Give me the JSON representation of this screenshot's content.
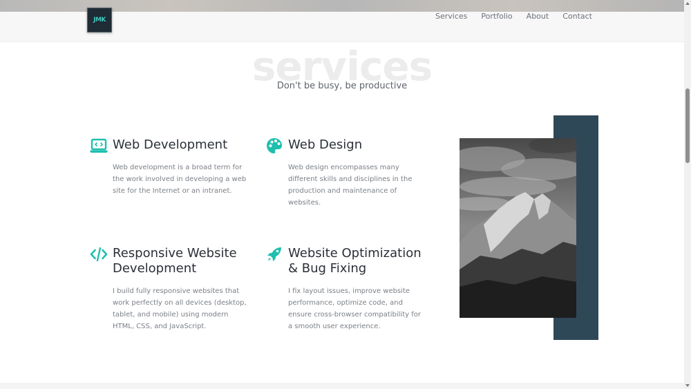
{
  "header": {
    "logo_text": "JMK",
    "nav": [
      {
        "label": "Services"
      },
      {
        "label": "Portfolio"
      },
      {
        "label": "About"
      },
      {
        "label": "Contact"
      }
    ]
  },
  "section": {
    "title": "services",
    "subtitle": "Don't be busy, be productive"
  },
  "services": [
    {
      "icon": "laptop-code-icon",
      "title": "Web Development",
      "description": "Web development is a broad term for the work involved in developing a web site for the Internet or an intranet."
    },
    {
      "icon": "palette-icon",
      "title": "Web Design",
      "description": "Web design encompasses many different skills and disciplines in the production and maintenance of websites."
    },
    {
      "icon": "code-icon",
      "title_line1": "Responsive Website",
      "title_line2": "Development",
      "description": "I build fully responsive websites that work perfectly on all devices (desktop, tablet, and mobile) using modern HTML, CSS, and JavaScript."
    },
    {
      "icon": "rocket-icon",
      "title_line1": "Website Optimization",
      "title_line2": "& Bug Fixing",
      "description": "I fix layout issues, improve website performance, optimize code, and ensure cross-browser compatibility for a smooth user experience."
    }
  ],
  "colors": {
    "accent": "#1fbfaf",
    "image_backdrop": "#2f4858"
  }
}
